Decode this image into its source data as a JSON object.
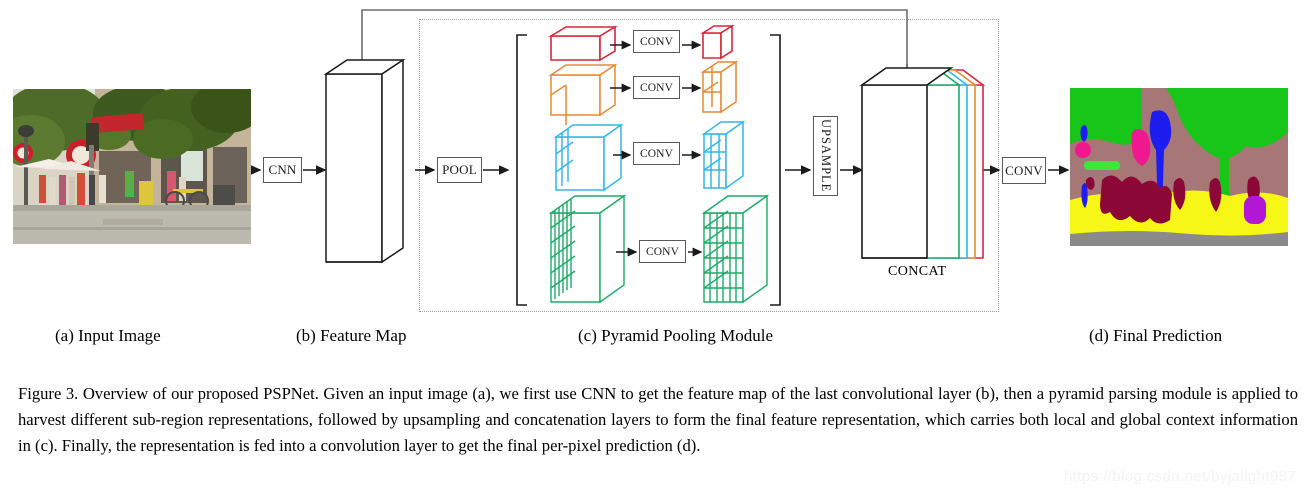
{
  "figure": {
    "number": "Figure 3.",
    "caption_text": "Figure 3. Overview of our proposed PSPNet. Given an input image (a), we first use CNN to get the feature map of the last convolutional layer (b), then a pyramid parsing module is applied to harvest different sub-region representations, followed by upsampling and concatenation layers to form the final feature representation, which carries both local and global context information in (c). Finally, the representation is fed into a convolution layer to get the final per-pixel prediction (d).",
    "watermark": "https://blog.csdn.net/byjalight987"
  },
  "subcaptions": [
    {
      "id": "a",
      "label": "(a) Input Image"
    },
    {
      "id": "b",
      "label": "(b) Feature Map"
    },
    {
      "id": "c",
      "label": "(c) Pyramid Pooling Module"
    },
    {
      "id": "d",
      "label": "(d) Final Prediction"
    }
  ],
  "blocks": {
    "cnn": "CNN",
    "pool": "POOL",
    "upsample": "UPSAMPLE",
    "final_conv": "CONV",
    "concat": "CONCAT",
    "conv": "CONV"
  },
  "pyramid_levels": [
    {
      "name": "level-1x1",
      "grid": 1,
      "color": "#d6283c",
      "conv_label": "CONV"
    },
    {
      "name": "level-2x2",
      "grid": 2,
      "color": "#e58a36",
      "conv_label": "CONV"
    },
    {
      "name": "level-3x3",
      "grid": 3,
      "color": "#35b6e8",
      "conv_label": "CONV"
    },
    {
      "name": "level-6x6",
      "grid": 6,
      "color": "#1faa68",
      "conv_label": "CONV"
    }
  ],
  "concat_slice_colors": [
    "#1faa68",
    "#35b6e8",
    "#e58a36",
    "#d6283c"
  ],
  "palette": {
    "line": "#1a1a1a",
    "box_stroke": "#595959",
    "dotted_region": "#9a9a9a",
    "skip_line": "#6e6e6e",
    "seg_vegetation": "#18c61a",
    "seg_building": "#a77676",
    "seg_ground": "#f6f617",
    "seg_person_pink": "#f0188f",
    "seg_pole_blue": "#1d1df0",
    "seg_dark_red": "#8c0836",
    "seg_road": "#8a8a8a",
    "seg_purple": "#b217d6"
  }
}
